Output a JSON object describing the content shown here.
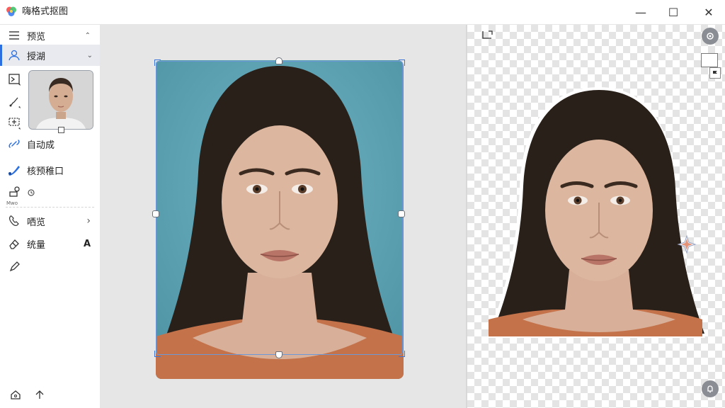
{
  "app": {
    "title": "嗨格式抠图"
  },
  "window": {
    "minimize": "—",
    "maximize": "☐",
    "close": "✕"
  },
  "sidebar": {
    "browse_label": "预览",
    "browse_caret": "⌃",
    "active_label": "授湖",
    "active_caret": "⌄",
    "auto_label": "自动成",
    "edge_label": "核预稚口",
    "small_text": "Mwo",
    "preview_label": "哂览",
    "preview_chevron": "›",
    "erase_label": "统量",
    "erase_glyph": "A"
  },
  "colors": {
    "accent": "#2b6fe0",
    "photo_background": "#62a8b8",
    "hair": "#2a201a",
    "skin": "#dcb69e",
    "shirt": "#c4724a"
  }
}
